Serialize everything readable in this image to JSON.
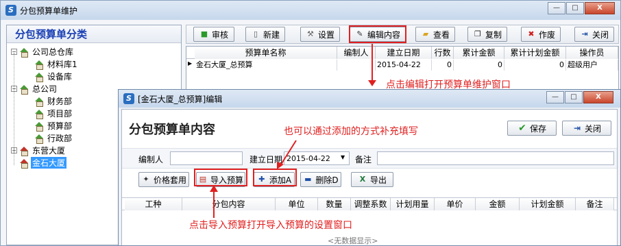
{
  "main_window": {
    "title": "分包预算单维护",
    "caption_buttons": {
      "minimize": "—",
      "maximize": "□",
      "close": "X"
    }
  },
  "left_panel": {
    "heading": "分包预算单分类",
    "tree": [
      {
        "label": "公司总仓库",
        "level": 0,
        "expander": "⊟"
      },
      {
        "label": "材料库1",
        "level": 1
      },
      {
        "label": "设备库",
        "level": 1
      },
      {
        "label": "总公司",
        "level": 0,
        "expander": "⊟"
      },
      {
        "label": "财务部",
        "level": 1
      },
      {
        "label": "项目部",
        "level": 1
      },
      {
        "label": "预算部",
        "level": 1
      },
      {
        "label": "行政部",
        "level": 1
      },
      {
        "label": "东营大厦",
        "level": 0,
        "expander": "⊞"
      },
      {
        "label": "金石大厦",
        "level": 0,
        "selected": true
      }
    ]
  },
  "toolbar": {
    "buttons": [
      {
        "label": "审核",
        "icon": "check-icon"
      },
      {
        "label": "新建",
        "icon": "new-doc-icon"
      },
      {
        "label": "设置",
        "icon": "wrench-icon"
      },
      {
        "label": "编辑内容",
        "icon": "edit-icon"
      },
      {
        "label": "查看",
        "icon": "folder-open-icon"
      },
      {
        "label": "复制",
        "icon": "copy-icon"
      },
      {
        "label": "作废",
        "icon": "x-icon"
      },
      {
        "label": "关闭",
        "icon": "exit-icon"
      }
    ]
  },
  "grid": {
    "columns": [
      "预算单名称",
      "编制人",
      "建立日期",
      "行数",
      "累计金额",
      "累计计划金额",
      "操作员"
    ],
    "rows": [
      {
        "marker": "▶",
        "cells": [
          "金石大厦_总预算",
          "",
          "2015-04-22",
          "0",
          "0",
          "0",
          "超级用户"
        ]
      }
    ]
  },
  "annotations": {
    "edit": "点击编辑打开预算单维护窗口",
    "add": "也可以通过添加的方式补充填写",
    "import": "点击导入预算打开导入预算的设置窗口"
  },
  "child_window": {
    "title": "[金石大厦_总预算]编辑",
    "heading": "分包预算单内容",
    "save_label": "保存",
    "close_label": "关闭",
    "form": {
      "author_label": "编制人",
      "author_value": "",
      "date_label": "建立日期",
      "date_value": "2015-04-22",
      "remark_label": "备注",
      "remark_value": ""
    },
    "actions": [
      {
        "label": "价格套用",
        "icon": "price-icon"
      },
      {
        "label": "导入预算",
        "icon": "import-icon"
      },
      {
        "label": "添加A",
        "icon": "plus-icon"
      },
      {
        "label": "删除D",
        "icon": "minus-icon"
      },
      {
        "label": "导出",
        "icon": "excel-icon"
      }
    ],
    "columns": [
      "工种",
      "分包内容",
      "单位",
      "数量",
      "调整系数",
      "计划用量",
      "单价",
      "金额",
      "计划金额",
      "备注"
    ],
    "empty_text": "<无数据显示>"
  },
  "colors": {
    "accent_blue": "#1a3fb4",
    "annotation_red": "#e02020",
    "selection": "#3399ff"
  }
}
